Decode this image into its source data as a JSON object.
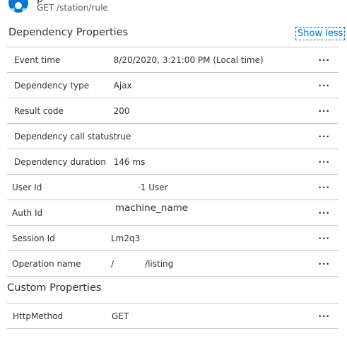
{
  "header": {
    "title_fragment": "p",
    "path": "GET /station/rule"
  },
  "dependency_properties": {
    "title": "Dependency Properties",
    "toggle_label": "Show less",
    "rows": [
      {
        "label": "Event time",
        "value": "8/20/2020, 3:21:00 PM (Local time)"
      },
      {
        "label": "Dependency type",
        "value": "Ajax"
      },
      {
        "label": "Result code",
        "value": "200"
      },
      {
        "label": "Dependency call status",
        "value": "true"
      },
      {
        "label": "Dependency duration",
        "value": "146 ms"
      }
    ]
  },
  "context_properties": {
    "rows": [
      {
        "label": "User Id",
        "value": "·1 User"
      },
      {
        "label": "Auth Id",
        "value": "machine_name"
      },
      {
        "label": "Session Id",
        "value": "Lm2q3"
      },
      {
        "label": "Operation name",
        "value_prefix": "/",
        "value_suffix": "/listing"
      }
    ]
  },
  "custom_properties": {
    "title": "Custom Properties",
    "rows": [
      {
        "label": "HttpMethod",
        "value": "GET"
      }
    ]
  },
  "more_label": "···",
  "colors": {
    "accent": "#0078d4",
    "divider": "#c8c6c4",
    "text": "#323130"
  }
}
